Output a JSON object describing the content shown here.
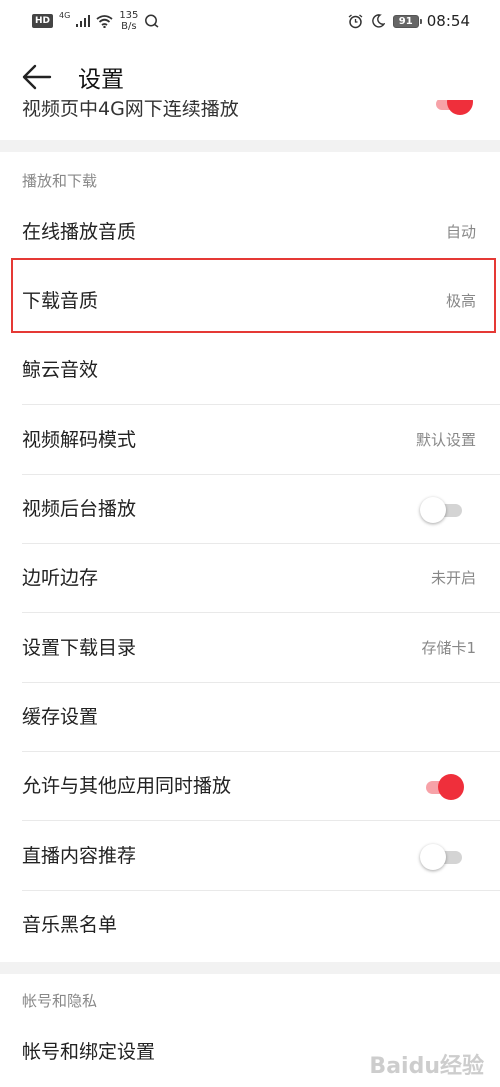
{
  "status_bar": {
    "left_badge": "HD",
    "signal": "4G",
    "speed_value": "135",
    "speed_unit": "B/s",
    "battery": "91",
    "time": "08:54"
  },
  "header": {
    "title": "设置"
  },
  "partial_row": {
    "label": "视频页中4G网下连续播放"
  },
  "sections": [
    {
      "header": "播放和下载",
      "rows": [
        {
          "label": "在线播放音质",
          "value": "自动"
        },
        {
          "label": "下载音质",
          "value": "极高"
        },
        {
          "label": "鲸云音效"
        },
        {
          "label": "视频解码模式",
          "value": "默认设置"
        },
        {
          "label": "视频后台播放",
          "toggle": "off"
        },
        {
          "label": "边听边存",
          "value": "未开启"
        },
        {
          "label": "设置下载目录",
          "value": "存储卡1"
        },
        {
          "label": "缓存设置"
        },
        {
          "label": "允许与其他应用同时播放",
          "toggle": "on"
        },
        {
          "label": "直播内容推荐",
          "toggle": "off"
        },
        {
          "label": "音乐黑名单"
        }
      ]
    },
    {
      "header": "帐号和隐私",
      "rows": [
        {
          "label": "帐号和绑定设置"
        }
      ]
    }
  ],
  "watermark": "Baidu经验",
  "colors": {
    "accent": "#ef2f3b",
    "highlight_border": "#e53935",
    "section_gap": "#f2f2f2"
  }
}
